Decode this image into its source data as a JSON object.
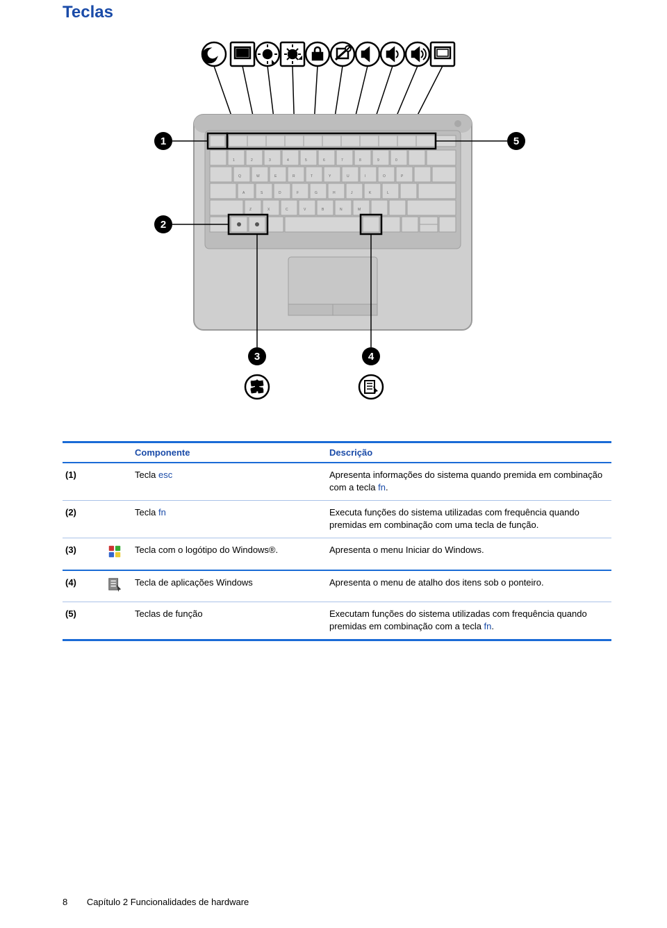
{
  "section_title": "Teclas",
  "table": {
    "headers": {
      "component": "Componente",
      "description": "Descrição"
    },
    "rows": [
      {
        "num": "(1)",
        "icon": null,
        "component_prefix": "Tecla ",
        "component_fn1": "esc",
        "component_suffix": "",
        "desc_prefix": "Apresenta informações do sistema quando premida em combinação com a tecla ",
        "desc_fn": "fn",
        "desc_suffix": "."
      },
      {
        "num": "(2)",
        "icon": null,
        "component_prefix": "Tecla ",
        "component_fn1": "fn",
        "component_suffix": "",
        "desc_prefix": "Executa funções do sistema utilizadas com frequência quando premidas em combinação com uma tecla de função.",
        "desc_fn": "",
        "desc_suffix": ""
      },
      {
        "num": "(3)",
        "icon": "windows-logo-icon",
        "component_prefix": "Tecla com o logótipo do Windows®.",
        "component_fn1": "",
        "component_suffix": "",
        "desc_prefix": "Apresenta o menu Iniciar do Windows.",
        "desc_fn": "",
        "desc_suffix": ""
      },
      {
        "num": "(4)",
        "icon": "windows-apps-icon",
        "component_prefix": "Tecla de aplicações Windows",
        "component_fn1": "",
        "component_suffix": "",
        "desc_prefix": "Apresenta o menu de atalho dos itens sob o ponteiro.",
        "desc_fn": "",
        "desc_suffix": ""
      },
      {
        "num": "(5)",
        "icon": null,
        "component_prefix": "Teclas de função",
        "component_fn1": "",
        "component_suffix": "",
        "desc_prefix": "Executam funções do sistema utilizadas com frequência quando premidas em combinação com a tecla ",
        "desc_fn": "fn",
        "desc_suffix": "."
      }
    ]
  },
  "footer": {
    "page_number": "8",
    "chapter": "Capítulo 2   Funcionalidades de hardware"
  }
}
